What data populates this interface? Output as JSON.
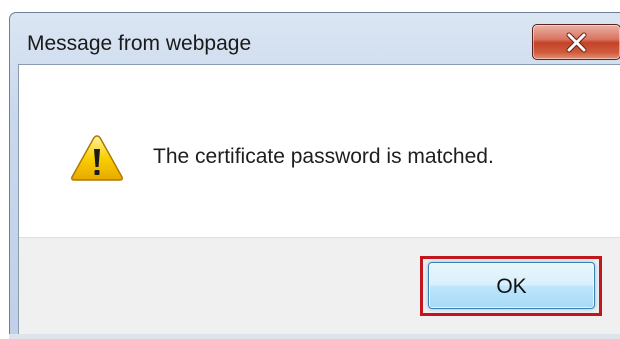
{
  "window": {
    "title": "Message from webpage",
    "close_icon": "close-x-icon",
    "close_accent": "#c3432a"
  },
  "message": {
    "icon": "warning-icon",
    "icon_color": "#f5c400",
    "text": "The certificate password is matched."
  },
  "buttons": {
    "ok_label": "OK",
    "highlight_color": "#c3161c"
  }
}
